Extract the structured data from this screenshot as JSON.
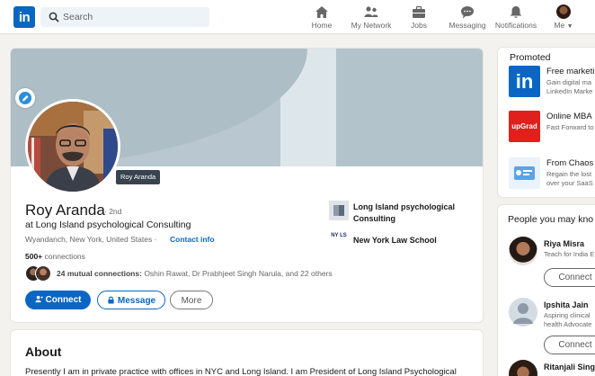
{
  "nav": {
    "logo": "in",
    "search_placeholder": "Search",
    "items": [
      {
        "label": "Home",
        "icon": "home-icon"
      },
      {
        "label": "My Network",
        "icon": "network-icon"
      },
      {
        "label": "Jobs",
        "icon": "briefcase-icon"
      },
      {
        "label": "Messaging",
        "icon": "messaging-icon"
      },
      {
        "label": "Notifications",
        "icon": "bell-icon"
      },
      {
        "label": "Me",
        "icon": "avatar"
      }
    ]
  },
  "profile": {
    "photo_tooltip": "Roy Aranda",
    "name": "Roy Aranda",
    "degree": "· 2nd",
    "headline": "at Long Island psychological Consulting",
    "location": "Wyandanch, New York, United States ·",
    "contact_info": "Contact info",
    "connections_count": "500+",
    "connections_label": "connections",
    "mutual_count": "24 mutual connections:",
    "mutual_names": "Oshin Rawat, Dr Prabhjeet Singh Narula, and 22 others",
    "buttons": {
      "connect": "Connect",
      "message": "Message",
      "more": "More"
    },
    "experience": [
      {
        "line1": "Long Island psychological",
        "line2": "Consulting"
      },
      {
        "line1": "New York Law School",
        "logo_text": "NY LS"
      }
    ]
  },
  "about": {
    "title": "About",
    "text": "Presently I am in private practice with offices in NYC and Long Island. I am President of Long Island Psychological"
  },
  "promoted": {
    "title": "Promoted",
    "ads": [
      {
        "title": "Free marketing",
        "desc1": "Gain digital ma",
        "desc2": "LinkedIn Marke",
        "logo": "in"
      },
      {
        "title": "Online MBA",
        "desc1": "Fast Forward to",
        "desc2": "",
        "logo": "upGrad"
      },
      {
        "title": "From Chaos t",
        "desc1": "Regain the lost",
        "desc2": "over your SaaS",
        "logo": ""
      }
    ]
  },
  "pymk": {
    "title": "People you may kno",
    "people": [
      {
        "name": "Riya Misra",
        "desc1": "Teach for India E",
        "desc2": "",
        "button": "Connect"
      },
      {
        "name": "Ipshita Jain",
        "desc1": "Aspiring clinical",
        "desc2": "health Advocate",
        "button": "Connect"
      },
      {
        "name": "Ritanjali Sing",
        "desc1": "",
        "desc2": "",
        "button": ""
      }
    ]
  },
  "colors": {
    "brand": "#0a66c2",
    "background": "#f3f2ef",
    "banner": "#b9c8d0"
  }
}
